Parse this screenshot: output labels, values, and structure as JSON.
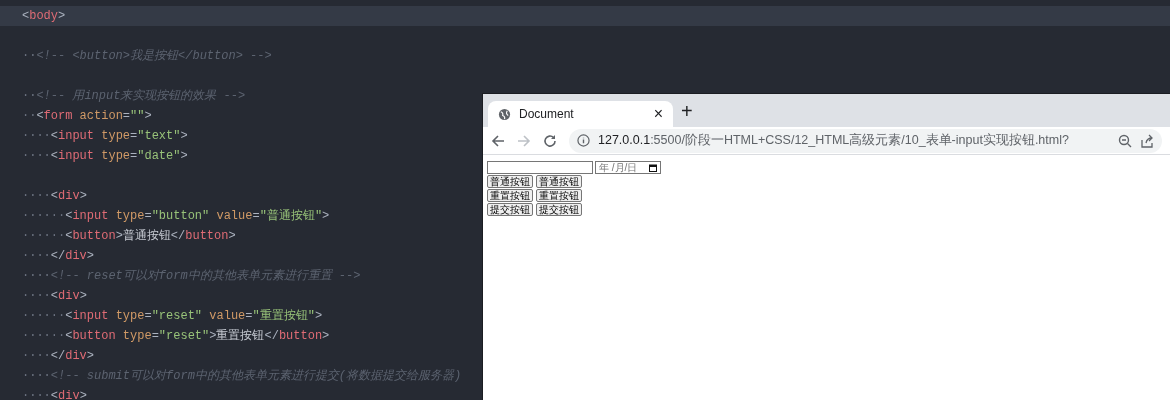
{
  "editor": {
    "lines": [
      {
        "highlighted": true,
        "tokens": [
          {
            "kind": "punct",
            "text": "<"
          },
          {
            "kind": "tag",
            "text": "body"
          },
          {
            "kind": "punct",
            "text": ">"
          }
        ]
      },
      {
        "highlighted": false
      },
      {
        "highlighted": false,
        "tokens": [
          {
            "kind": "indent",
            "text": "··"
          },
          {
            "kind": "comment",
            "text": "<!-- <button>我是按钮</button> -->"
          }
        ]
      },
      {
        "highlighted": false
      },
      {
        "highlighted": false,
        "tokens": [
          {
            "kind": "indent",
            "text": "··"
          },
          {
            "kind": "comment",
            "text": "<!-- 用input来实现按钮的效果 -->"
          }
        ]
      },
      {
        "highlighted": false,
        "tokens": [
          {
            "kind": "indent",
            "text": "··"
          },
          {
            "kind": "punct",
            "text": "<"
          },
          {
            "kind": "tag",
            "text": "form"
          },
          {
            "kind": "attr",
            "text": " action"
          },
          {
            "kind": "punct",
            "text": "="
          },
          {
            "kind": "string",
            "text": "\"\""
          },
          {
            "kind": "punct",
            "text": ">"
          }
        ]
      },
      {
        "highlighted": false,
        "tokens": [
          {
            "kind": "indent",
            "text": "····"
          },
          {
            "kind": "punct",
            "text": "<"
          },
          {
            "kind": "tag",
            "text": "input"
          },
          {
            "kind": "attr",
            "text": " type"
          },
          {
            "kind": "punct",
            "text": "="
          },
          {
            "kind": "string",
            "text": "\"text\""
          },
          {
            "kind": "punct",
            "text": ">"
          }
        ]
      },
      {
        "highlighted": false,
        "tokens": [
          {
            "kind": "indent",
            "text": "····"
          },
          {
            "kind": "punct",
            "text": "<"
          },
          {
            "kind": "tag",
            "text": "input"
          },
          {
            "kind": "attr",
            "text": " type"
          },
          {
            "kind": "punct",
            "text": "="
          },
          {
            "kind": "string",
            "text": "\"date\""
          },
          {
            "kind": "punct",
            "text": ">"
          }
        ]
      },
      {
        "highlighted": false
      },
      {
        "highlighted": false,
        "tokens": [
          {
            "kind": "indent",
            "text": "····"
          },
          {
            "kind": "punct",
            "text": "<"
          },
          {
            "kind": "tag",
            "text": "div"
          },
          {
            "kind": "punct",
            "text": ">"
          }
        ]
      },
      {
        "highlighted": false,
        "tokens": [
          {
            "kind": "indent",
            "text": "······"
          },
          {
            "kind": "punct",
            "text": "<"
          },
          {
            "kind": "tag",
            "text": "input"
          },
          {
            "kind": "attr",
            "text": " type"
          },
          {
            "kind": "punct",
            "text": "="
          },
          {
            "kind": "string",
            "text": "\"button\""
          },
          {
            "kind": "attr",
            "text": " value"
          },
          {
            "kind": "punct",
            "text": "="
          },
          {
            "kind": "string",
            "text": "\"普通按钮\""
          },
          {
            "kind": "punct",
            "text": ">"
          }
        ]
      },
      {
        "highlighted": false,
        "tokens": [
          {
            "kind": "indent",
            "text": "······"
          },
          {
            "kind": "punct",
            "text": "<"
          },
          {
            "kind": "tag",
            "text": "button"
          },
          {
            "kind": "punct",
            "text": ">"
          },
          {
            "kind": "plain",
            "text": "普通按钮"
          },
          {
            "kind": "punct",
            "text": "</"
          },
          {
            "kind": "tag",
            "text": "button"
          },
          {
            "kind": "punct",
            "text": ">"
          }
        ]
      },
      {
        "highlighted": false,
        "tokens": [
          {
            "kind": "indent",
            "text": "····"
          },
          {
            "kind": "punct",
            "text": "</"
          },
          {
            "kind": "tag",
            "text": "div"
          },
          {
            "kind": "punct",
            "text": ">"
          }
        ]
      },
      {
        "highlighted": false,
        "tokens": [
          {
            "kind": "indent",
            "text": "····"
          },
          {
            "kind": "comment",
            "text": "<!-- reset可以对form中的其他表单元素进行重置 -->"
          }
        ]
      },
      {
        "highlighted": false,
        "tokens": [
          {
            "kind": "indent",
            "text": "····"
          },
          {
            "kind": "punct",
            "text": "<"
          },
          {
            "kind": "tag",
            "text": "div"
          },
          {
            "kind": "punct",
            "text": ">"
          }
        ]
      },
      {
        "highlighted": false,
        "tokens": [
          {
            "kind": "indent",
            "text": "······"
          },
          {
            "kind": "punct",
            "text": "<"
          },
          {
            "kind": "tag",
            "text": "input"
          },
          {
            "kind": "attr",
            "text": " type"
          },
          {
            "kind": "punct",
            "text": "="
          },
          {
            "kind": "string",
            "text": "\"reset\""
          },
          {
            "kind": "attr",
            "text": " value"
          },
          {
            "kind": "punct",
            "text": "="
          },
          {
            "kind": "string",
            "text": "\"重置按钮\""
          },
          {
            "kind": "punct",
            "text": ">"
          }
        ]
      },
      {
        "highlighted": false,
        "tokens": [
          {
            "kind": "indent",
            "text": "······"
          },
          {
            "kind": "punct",
            "text": "<"
          },
          {
            "kind": "tag",
            "text": "button"
          },
          {
            "kind": "attr",
            "text": " type"
          },
          {
            "kind": "punct",
            "text": "="
          },
          {
            "kind": "string",
            "text": "\"reset\""
          },
          {
            "kind": "punct",
            "text": ">"
          },
          {
            "kind": "plain",
            "text": "重置按钮"
          },
          {
            "kind": "punct",
            "text": "</"
          },
          {
            "kind": "tag",
            "text": "button"
          },
          {
            "kind": "punct",
            "text": ">"
          }
        ]
      },
      {
        "highlighted": false,
        "tokens": [
          {
            "kind": "indent",
            "text": "····"
          },
          {
            "kind": "punct",
            "text": "</"
          },
          {
            "kind": "tag",
            "text": "div"
          },
          {
            "kind": "punct",
            "text": ">"
          }
        ]
      },
      {
        "highlighted": false,
        "tokens": [
          {
            "kind": "indent",
            "text": "····"
          },
          {
            "kind": "comment",
            "text": "<!-- submit可以对form中的其他表单元素进行提交(将数据提交给服务器)"
          }
        ]
      },
      {
        "highlighted": false,
        "tokens": [
          {
            "kind": "indent",
            "text": "····"
          },
          {
            "kind": "punct",
            "text": "<"
          },
          {
            "kind": "tag",
            "text": "div"
          },
          {
            "kind": "punct",
            "text": ">"
          }
        ]
      }
    ]
  },
  "browser": {
    "tab": {
      "title": "Document",
      "close": "×",
      "selected": true
    },
    "new_tab": "+",
    "address_bar": {
      "host": "127.0.0.1",
      "rest": ":5500/阶段一HTML+CSS/12_HTML高级元素/10_表单-input实现按钮.html?"
    },
    "forward_disabled": true,
    "page": {
      "text_field": {
        "kind": "text"
      },
      "date_field": {
        "placeholder": "年 /月/日"
      },
      "button_rows": [
        [
          "普通按钮",
          "普通按钮"
        ],
        [
          "重置按钮",
          "重置按钮"
        ],
        [
          "提交按钮",
          "提交按钮"
        ]
      ]
    }
  }
}
